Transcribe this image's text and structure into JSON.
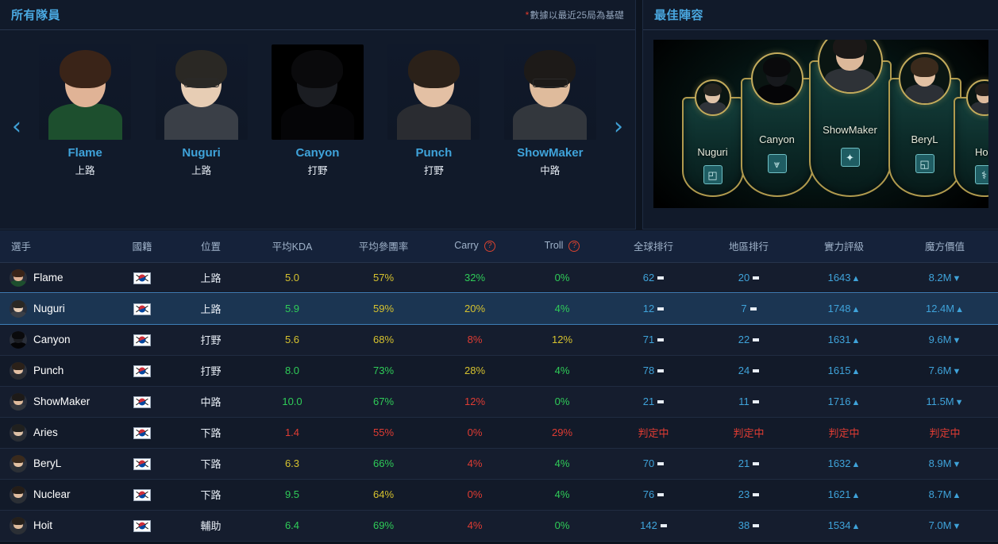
{
  "left_panel": {
    "title": "所有隊員",
    "note_star": "*",
    "note": "數據以最近25局為基礎",
    "prev_label": "‹",
    "next_label": "›",
    "cards": [
      {
        "name": "Flame",
        "role": "上路",
        "hair": "#3a2418",
        "skin": "#e0b396",
        "shirt": "#1d4f2e"
      },
      {
        "name": "Nuguri",
        "role": "上路",
        "hair": "#2a2824",
        "skin": "#e7cdb4",
        "shirt": "#3a3f47",
        "glasses": true
      },
      {
        "name": "Canyon",
        "role": "打野",
        "hair": "#0a0a0c",
        "skin": "#1b1d22",
        "shirt": "#050507",
        "dark": true
      },
      {
        "name": "Punch",
        "role": "打野",
        "hair": "#2b2119",
        "skin": "#e3c0a4",
        "shirt": "#2a2c31"
      },
      {
        "name": "ShowMaker",
        "role": "中路",
        "hair": "#1d1a18",
        "skin": "#dfbb9c",
        "shirt": "#33373d",
        "glasses": true
      }
    ]
  },
  "right_panel": {
    "title": "最佳陣容",
    "lineup": [
      {
        "name": "Nuguri",
        "role_icon": "◰",
        "hair": "#26241f",
        "skin": "#e0c3a8",
        "shirt": "#2f3339"
      },
      {
        "name": "Canyon",
        "role_icon": "⩔",
        "hair": "#0a0a0c",
        "skin": "#17191d",
        "shirt": "#050507"
      },
      {
        "name": "ShowMaker",
        "role_icon": "✦",
        "hair": "#1b1817",
        "skin": "#dcb89a",
        "shirt": "#2e3237"
      },
      {
        "name": "BeryL",
        "role_icon": "◱",
        "hair": "#3a2a1c",
        "skin": "#e2c1a3",
        "shirt": "#2c3036"
      },
      {
        "name": "Hoit",
        "role_icon": "⚕",
        "hair": "#241f1b",
        "skin": "#ddbb9d",
        "shirt": "#2b2f35"
      }
    ]
  },
  "table": {
    "columns": [
      {
        "key": "player",
        "label": "選手"
      },
      {
        "key": "country",
        "label": "國籍"
      },
      {
        "key": "pos",
        "label": "位置"
      },
      {
        "key": "kda",
        "label": "平均KDA"
      },
      {
        "key": "kp",
        "label": "平均參團率"
      },
      {
        "key": "carry",
        "label": "Carry",
        "help": "?"
      },
      {
        "key": "troll",
        "label": "Troll",
        "help": "?"
      },
      {
        "key": "global",
        "label": "全球排行"
      },
      {
        "key": "region",
        "label": "地區排行"
      },
      {
        "key": "rating",
        "label": "實力評級"
      },
      {
        "key": "value",
        "label": "魔方價值"
      }
    ],
    "rows": [
      {
        "player": "Flame",
        "flag": "KR",
        "pos": "上路",
        "kda": "5.0",
        "kda_color": "yellow",
        "kp": "57%",
        "kp_color": "yellow",
        "carry": "32%",
        "carry_color": "green",
        "troll": "0%",
        "troll_color": "green",
        "global": "62",
        "global_trend": "flat",
        "region": "20",
        "region_trend": "flat",
        "rating": "1643",
        "rating_trend": "up",
        "value": "8.2M",
        "value_trend": "down",
        "selected": false,
        "avatar": {
          "hair": "#3a2418",
          "skin": "#e0b396",
          "shirt": "#1d4f2e"
        }
      },
      {
        "player": "Nuguri",
        "flag": "KR",
        "pos": "上路",
        "kda": "5.9",
        "kda_color": "green",
        "kp": "59%",
        "kp_color": "yellow",
        "carry": "20%",
        "carry_color": "yellow",
        "troll": "4%",
        "troll_color": "green",
        "global": "12",
        "global_trend": "flat",
        "region": "7",
        "region_trend": "flat",
        "rating": "1748",
        "rating_trend": "up",
        "value": "12.4M",
        "value_trend": "up",
        "selected": true,
        "avatar": {
          "hair": "#2a2824",
          "skin": "#e7cdb4",
          "shirt": "#3a3f47"
        }
      },
      {
        "player": "Canyon",
        "flag": "KR",
        "pos": "打野",
        "kda": "5.6",
        "kda_color": "yellow",
        "kp": "68%",
        "kp_color": "yellow",
        "carry": "8%",
        "carry_color": "red",
        "troll": "12%",
        "troll_color": "yellow",
        "global": "71",
        "global_trend": "flat",
        "region": "22",
        "region_trend": "flat",
        "rating": "1631",
        "rating_trend": "up",
        "value": "9.6M",
        "value_trend": "down",
        "selected": false,
        "avatar": {
          "hair": "#0a0a0c",
          "skin": "#1b1d22",
          "shirt": "#050507"
        }
      },
      {
        "player": "Punch",
        "flag": "KR",
        "pos": "打野",
        "kda": "8.0",
        "kda_color": "green",
        "kp": "73%",
        "kp_color": "green",
        "carry": "28%",
        "carry_color": "yellow",
        "troll": "4%",
        "troll_color": "green",
        "global": "78",
        "global_trend": "flat",
        "region": "24",
        "region_trend": "flat",
        "rating": "1615",
        "rating_trend": "up",
        "value": "7.6M",
        "value_trend": "down",
        "selected": false,
        "avatar": {
          "hair": "#2b2119",
          "skin": "#e3c0a4",
          "shirt": "#2a2c31"
        }
      },
      {
        "player": "ShowMaker",
        "flag": "KR",
        "pos": "中路",
        "kda": "10.0",
        "kda_color": "green",
        "kp": "67%",
        "kp_color": "green",
        "carry": "12%",
        "carry_color": "red",
        "troll": "0%",
        "troll_color": "green",
        "global": "21",
        "global_trend": "flat",
        "region": "11",
        "region_trend": "flat",
        "rating": "1716",
        "rating_trend": "up",
        "value": "11.5M",
        "value_trend": "down",
        "selected": false,
        "avatar": {
          "hair": "#1d1a18",
          "skin": "#dfbb9c",
          "shirt": "#33373d"
        }
      },
      {
        "player": "Aries",
        "flag": "KR",
        "pos": "下路",
        "kda": "1.4",
        "kda_color": "red",
        "kp": "55%",
        "kp_color": "red",
        "carry": "0%",
        "carry_color": "red",
        "troll": "29%",
        "troll_color": "red",
        "global": "判定中",
        "global_trend": "none",
        "global_color": "red",
        "region": "判定中",
        "region_trend": "none",
        "region_color": "red",
        "rating": "判定中",
        "rating_trend": "none",
        "rating_color": "red",
        "value": "判定中",
        "value_trend": "none",
        "value_color": "red",
        "selected": false,
        "avatar": {
          "hair": "#20201e",
          "skin": "#dcc0a6",
          "shirt": "#2a2e34"
        }
      },
      {
        "player": "BeryL",
        "flag": "KR",
        "pos": "下路",
        "kda": "6.3",
        "kda_color": "yellow",
        "kp": "66%",
        "kp_color": "green",
        "carry": "4%",
        "carry_color": "red",
        "troll": "4%",
        "troll_color": "green",
        "global": "70",
        "global_trend": "flat",
        "region": "21",
        "region_trend": "flat",
        "rating": "1632",
        "rating_trend": "up",
        "value": "8.9M",
        "value_trend": "down",
        "selected": false,
        "avatar": {
          "hair": "#3a2a1c",
          "skin": "#e2c1a3",
          "shirt": "#2c3036"
        }
      },
      {
        "player": "Nuclear",
        "flag": "KR",
        "pos": "下路",
        "kda": "9.5",
        "kda_color": "green",
        "kp": "64%",
        "kp_color": "yellow",
        "carry": "0%",
        "carry_color": "red",
        "troll": "4%",
        "troll_color": "green",
        "global": "76",
        "global_trend": "flat",
        "region": "23",
        "region_trend": "flat",
        "rating": "1621",
        "rating_trend": "up",
        "value": "8.7M",
        "value_trend": "up",
        "selected": false,
        "avatar": {
          "hair": "#241d18",
          "skin": "#e0bda0",
          "shirt": "#2b2f35"
        }
      },
      {
        "player": "Hoit",
        "flag": "KR",
        "pos": "輔助",
        "kda": "6.4",
        "kda_color": "green",
        "kp": "69%",
        "kp_color": "green",
        "carry": "4%",
        "carry_color": "red",
        "troll": "0%",
        "troll_color": "green",
        "global": "142",
        "global_trend": "flat",
        "region": "38",
        "region_trend": "flat",
        "rating": "1534",
        "rating_trend": "up",
        "value": "7.0M",
        "value_trend": "down",
        "selected": false,
        "avatar": {
          "hair": "#241f1b",
          "skin": "#ddbb9d",
          "shirt": "#2b2f35"
        }
      }
    ]
  },
  "colors": {
    "accent": "#3fa3da",
    "green": "#2fcc58",
    "yellow": "#d6c22e",
    "red": "#e03c33",
    "panel_bg": "#111a2a",
    "page_bg": "#0d1420"
  }
}
